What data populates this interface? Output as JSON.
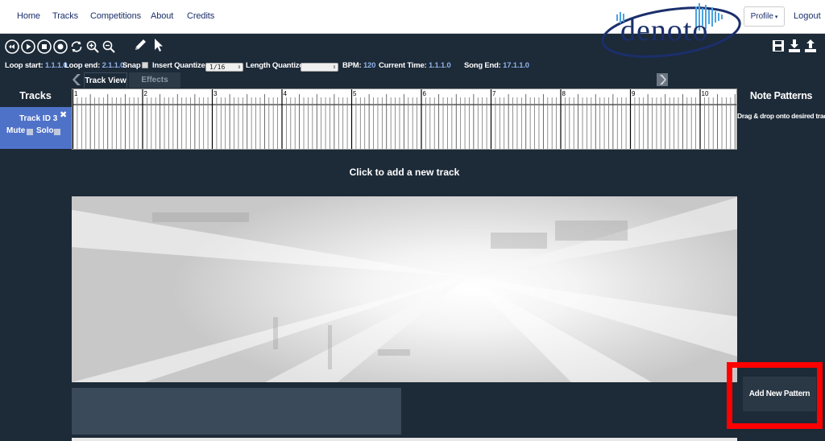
{
  "navbar": {
    "links": [
      "Home",
      "Tracks",
      "Competitions",
      "About",
      "Credits"
    ],
    "logo_text": "denoto",
    "profile_label": "Profile",
    "logout_label": "Logout"
  },
  "toolbar": {
    "transport_icons": [
      "rewind-icon",
      "play-icon",
      "stop-icon",
      "record-icon",
      "loop-icon",
      "zoom-in-icon",
      "zoom-out-icon",
      "pencil-icon",
      "pointer-icon"
    ],
    "file_icons": [
      "save-icon",
      "download-icon",
      "upload-icon"
    ]
  },
  "status": {
    "loop_start_label": "Loop start:",
    "loop_start_value": "1.1.1.0",
    "loop_end_label": "Loop end:",
    "loop_end_value": "2.1.1.0",
    "snap_label": "Snap",
    "snap_checked": true,
    "insert_quantize_label": "Insert Quantize:",
    "insert_quantize_value": "1/16",
    "length_quantize_label": "Length Quantize:",
    "length_quantize_value": "",
    "bpm_label": "BPM:",
    "bpm_value": "120",
    "current_time_label": "Current Time:",
    "current_time_value": "1.1.1.0",
    "song_end_label": "Song End:",
    "song_end_value": "17.1.1.0"
  },
  "tabs": [
    {
      "label": "Track View",
      "active": true
    },
    {
      "label": "Effects Graph",
      "active": false
    }
  ],
  "tracks_panel": {
    "heading": "Tracks",
    "tracks": [
      {
        "name": "Track ID 3",
        "mute_label": "Mute",
        "solo_label": "Solo"
      }
    ]
  },
  "timeline": {
    "bar_numbers": [
      "1",
      "2",
      "3",
      "4",
      "5",
      "6",
      "7",
      "8",
      "9",
      "10"
    ]
  },
  "main": {
    "add_track_label": "Click to add a new track"
  },
  "patterns_panel": {
    "heading": "Note Patterns",
    "hint": "Drag & drop onto desired track",
    "add_button_label": "Add New Pattern"
  },
  "colors": {
    "background": "#1d2a38",
    "accent_blue": "#4f72c9",
    "value_blue": "#8fb0e8",
    "highlight_red": "#ff0000",
    "brand_navy": "#1b2f6b"
  }
}
